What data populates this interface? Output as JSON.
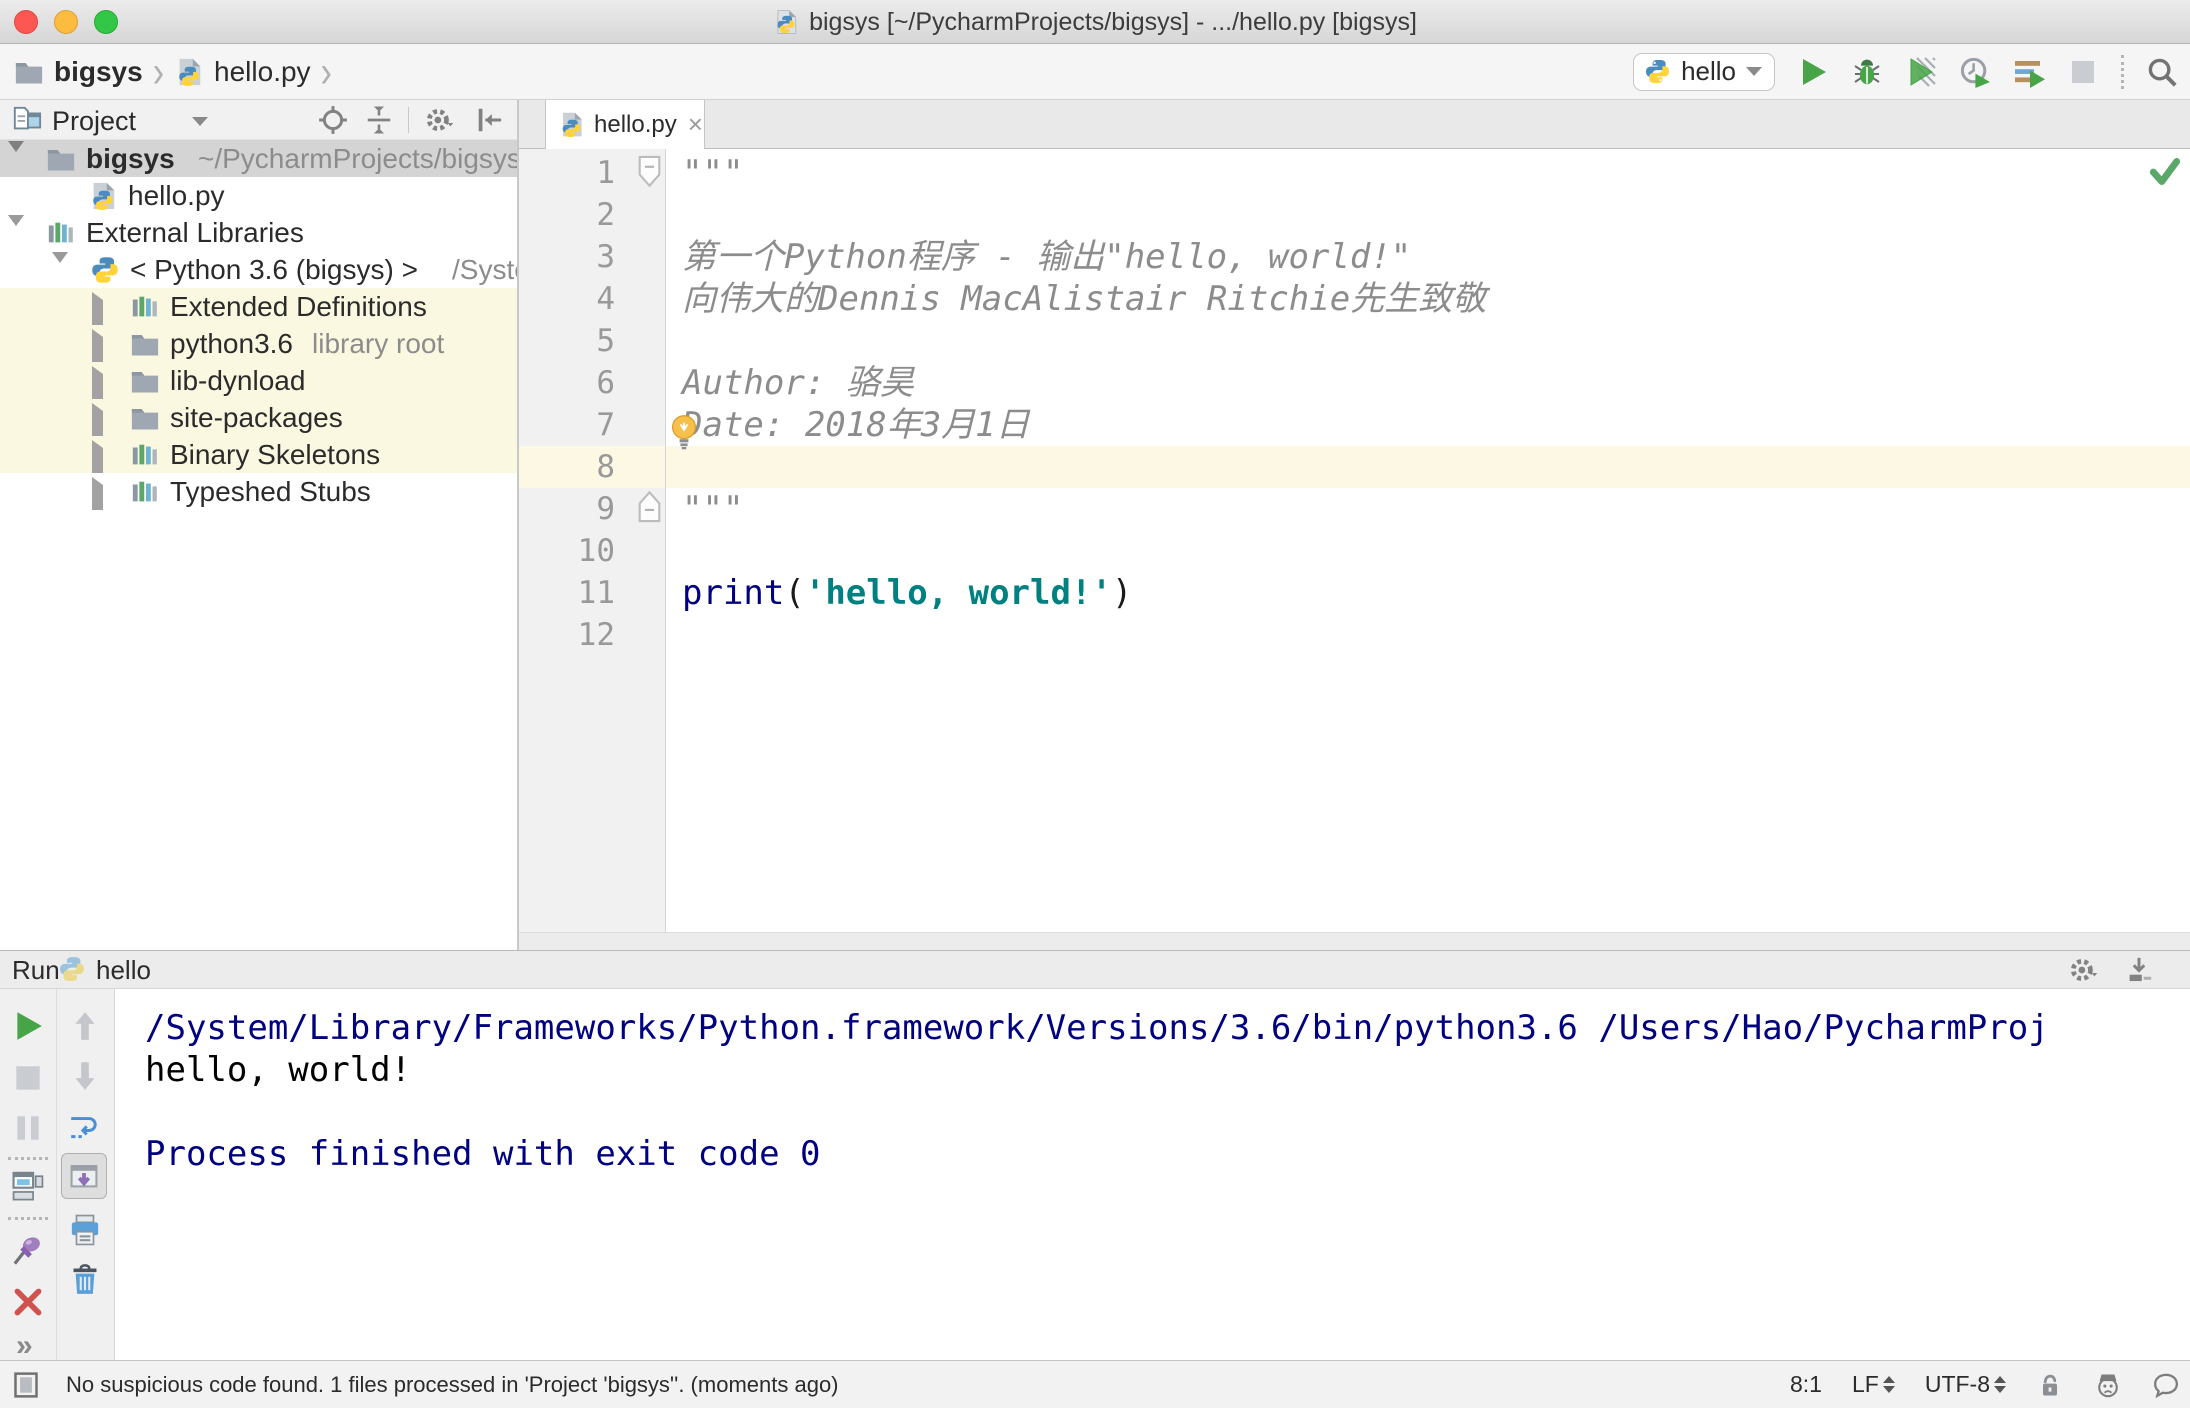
{
  "window": {
    "title": "bigsys [~/PycharmProjects/bigsys] - .../hello.py [bigsys]"
  },
  "breadcrumbs": {
    "project": "bigsys",
    "file": "hello.py"
  },
  "toolbar": {
    "run_config": "hello"
  },
  "project_panel": {
    "title": "Project",
    "rows": [
      {
        "label": "bigsys",
        "suffix": "~/PycharmProjects/bigsys"
      },
      {
        "label": "hello.py",
        "suffix": ""
      },
      {
        "label": "External Libraries",
        "suffix": ""
      },
      {
        "label": "< Python 3.6 (bigsys) >",
        "suffix": "/System"
      },
      {
        "label": "Extended Definitions",
        "suffix": ""
      },
      {
        "label": "python3.6",
        "suffix": "library root"
      },
      {
        "label": "lib-dynload",
        "suffix": ""
      },
      {
        "label": "site-packages",
        "suffix": ""
      },
      {
        "label": "Binary Skeletons",
        "suffix": ""
      },
      {
        "label": "Typeshed Stubs",
        "suffix": ""
      }
    ]
  },
  "editor": {
    "tab": "hello.py",
    "tab_close": "×",
    "lines": [
      {
        "n": "1",
        "t": "\"\"\""
      },
      {
        "n": "2",
        "t": ""
      },
      {
        "n": "3",
        "t": "第一个Python程序 - 输出\"hello, world!\""
      },
      {
        "n": "4",
        "t": "向伟大的Dennis MacAlistair Ritchie先生致敬"
      },
      {
        "n": "5",
        "t": ""
      },
      {
        "n": "6",
        "t": "Author: 骆昊"
      },
      {
        "n": "7",
        "t": "Date: 2018年3月1日"
      },
      {
        "n": "8",
        "t": ""
      },
      {
        "n": "9",
        "t": "\"\"\""
      },
      {
        "n": "10",
        "t": ""
      },
      {
        "n": "11",
        "t": ""
      },
      {
        "n": "12",
        "t": ""
      }
    ],
    "code_line_11": {
      "keyword": "print",
      "open_paren": "(",
      "string": "'hello, world!'",
      "close_paren": ")"
    }
  },
  "run_panel": {
    "title": "Run",
    "config": "hello",
    "more_label": "»",
    "console_line_1": "/System/Library/Frameworks/Python.framework/Versions/3.6/bin/python3.6 /Users/Hao/PycharmProj",
    "console_line_2": "hello, world!",
    "console_line_3": "",
    "console_line_4": "Process finished with exit code 0"
  },
  "status_bar": {
    "message": "No suspicious code found. 1 files processed in 'Project 'bigsys''. (moments ago)",
    "caret": "8:1",
    "line_separator": "LF",
    "encoding": "UTF-8"
  },
  "colors": {
    "run_green": "#47a447",
    "keyword": "#000080",
    "string": "#008080",
    "caret_line": "#fcf8e3",
    "selection": "#d4d4d4"
  }
}
